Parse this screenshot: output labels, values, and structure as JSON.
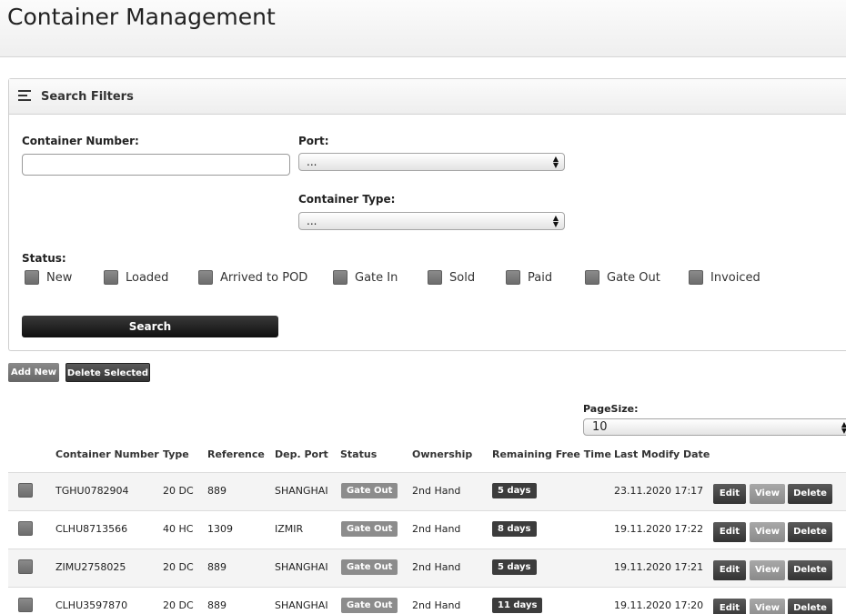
{
  "page": {
    "title": "Container Management"
  },
  "filters": {
    "title": "Search Filters",
    "container_number_label": "Container Number:",
    "container_number_value": "",
    "port_label": "Port:",
    "port_value": "...",
    "container_type_label": "Container Type:",
    "container_type_value": "...",
    "status_label": "Status:",
    "statuses": [
      "New",
      "Loaded",
      "Arrived to POD",
      "Gate In",
      "Sold",
      "Paid",
      "Gate Out",
      "Invoiced"
    ],
    "search_label": "Search"
  },
  "actions": {
    "add_new": "Add New",
    "delete_selected": "Delete Selected"
  },
  "pagesize": {
    "label": "PageSize:",
    "value": "10"
  },
  "table": {
    "columns": [
      "Container Number",
      "Type",
      "Reference",
      "Dep. Port",
      "Status",
      "Ownership",
      "Remaining Free Time",
      "Last Modify Date"
    ],
    "rows": [
      {
        "number": "TGHU0782904",
        "type": "20 DC",
        "reference": "889",
        "port": "SHANGHAI",
        "status": "Gate Out",
        "ownership": "2nd Hand",
        "free": "5 days",
        "date": "23.11.2020 17:17"
      },
      {
        "number": "CLHU8713566",
        "type": "40 HC",
        "reference": "1309",
        "port": "IZMIR",
        "status": "Gate Out",
        "ownership": "2nd Hand",
        "free": "8 days",
        "date": "19.11.2020 17:22"
      },
      {
        "number": "ZIMU2758025",
        "type": "20 DC",
        "reference": "889",
        "port": "SHANGHAI",
        "status": "Gate Out",
        "ownership": "2nd Hand",
        "free": "5 days",
        "date": "19.11.2020 17:21"
      },
      {
        "number": "CLHU3597870",
        "type": "20 DC",
        "reference": "889",
        "port": "SHANGHAI",
        "status": "Gate Out",
        "ownership": "2nd Hand",
        "free": "11 days",
        "date": "19.11.2020 17:20"
      }
    ],
    "row_buttons": {
      "edit": "Edit",
      "view": "View",
      "delete": "Delete"
    }
  }
}
